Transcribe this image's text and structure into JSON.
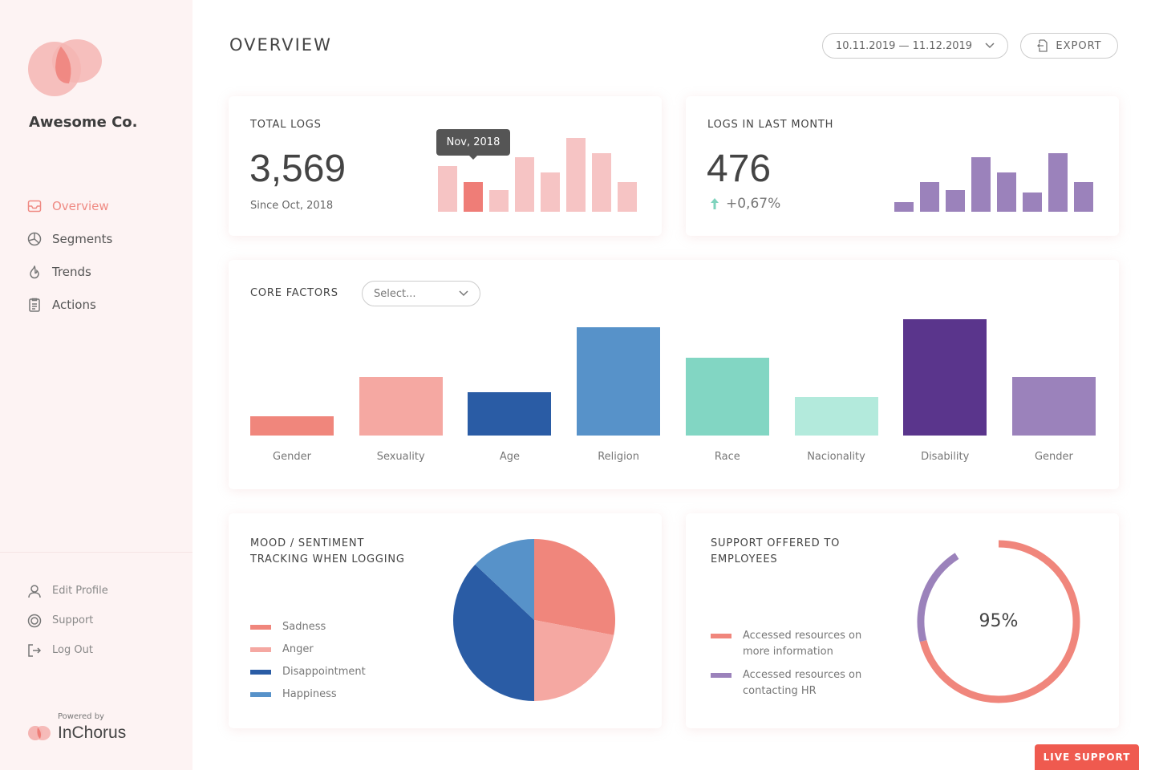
{
  "colors": {
    "accent": "#ef8a83",
    "sidebar_bg": "#fdf3f3",
    "pink_bar": "#f6c4c4",
    "pink_active": "#ef7d77",
    "purple_bar": "#9b82bb",
    "up": "#7fd3bd",
    "live": "#ef5a4f"
  },
  "sidebar": {
    "company": "Awesome Co.",
    "nav": [
      {
        "label": "Overview",
        "icon": "inbox-icon",
        "active": true
      },
      {
        "label": "Segments",
        "icon": "pie-chart-icon"
      },
      {
        "label": "Trends",
        "icon": "flame-icon"
      },
      {
        "label": "Actions",
        "icon": "clipboard-icon"
      }
    ],
    "bottom": [
      {
        "label": "Edit Profile",
        "icon": "user-icon"
      },
      {
        "label": "Support",
        "icon": "lifebuoy-icon"
      },
      {
        "label": "Log Out",
        "icon": "logout-icon"
      }
    ],
    "powered_by": "Powered by",
    "brand": "InChorus"
  },
  "header": {
    "title": "OVERVIEW",
    "date_range": "10.11.2019 — 11.12.2019",
    "export_label": "EXPORT"
  },
  "total_logs": {
    "title": "TOTAL LOGS",
    "value": "3,569",
    "since": "Since Oct, 2018",
    "tooltip": "Nov, 2018",
    "active_index": 1,
    "bars": [
      57,
      37,
      27,
      68,
      49,
      92,
      73,
      37
    ]
  },
  "last_month": {
    "title": "LOGS IN LAST MONTH",
    "value": "476",
    "change": "+0,67%",
    "bars": [
      12,
      37,
      27,
      68,
      49,
      24,
      73,
      37
    ]
  },
  "core_factors": {
    "title": "CORE FACTORS",
    "select_placeholder": "Select...",
    "chart_data": {
      "type": "bar",
      "categories": [
        "Gender",
        "Sexuality",
        "Age",
        "Religion",
        "Race",
        "Nacionality",
        "Disability",
        "Gender"
      ],
      "values": [
        24,
        73,
        54,
        135,
        97,
        48,
        145,
        73
      ],
      "colors": [
        "#f0867c",
        "#f5a8a2",
        "#2a5ca5",
        "#5792c9",
        "#82d6c3",
        "#b3eadc",
        "#5a358c",
        "#9b82bb"
      ]
    }
  },
  "mood": {
    "title_line1": "MOOD / SENTIMENT",
    "title_line2": "TRACKING WHEN LOGGING",
    "chart_data": {
      "type": "pie",
      "series": [
        {
          "name": "Sadness",
          "value": 28,
          "color": "#f0867c"
        },
        {
          "name": "Anger",
          "value": 22,
          "color": "#f5a8a2"
        },
        {
          "name": "Disappointment",
          "value": 37,
          "color": "#2a5ca5"
        },
        {
          "name": "Happiness",
          "value": 13,
          "color": "#5792c9"
        }
      ]
    }
  },
  "support": {
    "title_line1": "SUPPORT OFFERED TO",
    "title_line2": "EMPLOYEES",
    "center_label": "95%",
    "chart_data": {
      "type": "pie",
      "series": [
        {
          "name": "Accessed resources on more information",
          "value": 71,
          "color": "#f0867c"
        },
        {
          "name": "Accessed resources on contacting HR",
          "value": 20,
          "color": "#9b82bb"
        }
      ]
    },
    "legend": [
      {
        "line1": "Accessed resources on",
        "line2": "more information",
        "color": "#f0867c"
      },
      {
        "line1": "Accessed resources on",
        "line2": "contacting HR",
        "color": "#9b82bb"
      }
    ]
  },
  "live_support": "LIVE SUPPORT"
}
